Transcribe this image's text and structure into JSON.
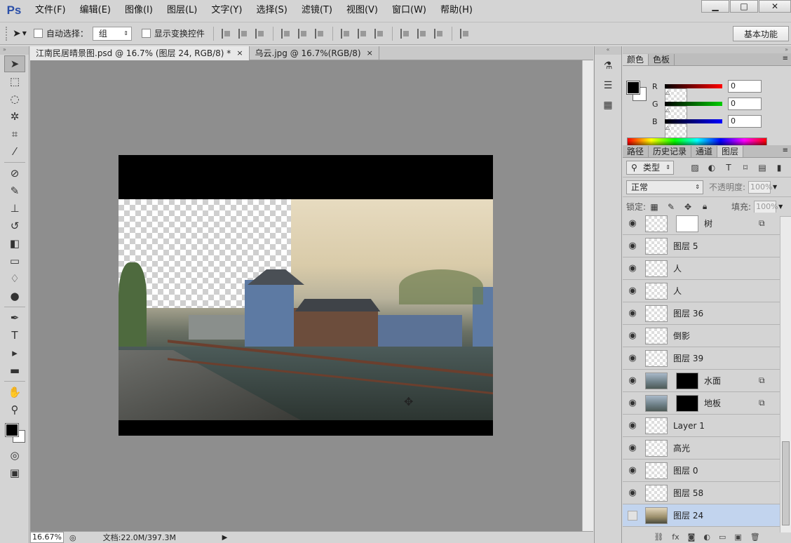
{
  "app": {
    "logo": "Ps"
  },
  "menu": [
    "文件(F)",
    "编辑(E)",
    "图像(I)",
    "图层(L)",
    "文字(Y)",
    "选择(S)",
    "滤镜(T)",
    "视图(V)",
    "窗口(W)",
    "帮助(H)"
  ],
  "window_controls": {
    "minimize": "▁",
    "maximize": "□",
    "close": "✕"
  },
  "options": {
    "auto_select_label": "自动选择：",
    "auto_select_value": "组",
    "transform_controls_label": "显示变换控件",
    "workspace": "基本功能"
  },
  "tabs": [
    {
      "title": "江南民居晴景图.psd @ 16.7% (图层 24, RGB/8) *",
      "close": "×"
    },
    {
      "title": "乌云.jpg @ 16.7%(RGB/8)",
      "close": "×"
    }
  ],
  "status": {
    "zoom": "16.67%",
    "doc": "文档:22.0M/397.3M",
    "arrow": "▶"
  },
  "color_panel": {
    "tabs": [
      "颜色",
      "色板"
    ],
    "r_label": "R",
    "g_label": "G",
    "b_label": "B",
    "r": "0",
    "g": "0",
    "b": "0"
  },
  "layers_panel": {
    "tabs": [
      "路径",
      "历史记录",
      "通道",
      "图层"
    ],
    "filter_kind": "类型",
    "blend_mode": "正常",
    "opacity_label": "不透明度:",
    "opacity": "100%",
    "lock_label": "锁定:",
    "fill_label": "填充:",
    "fill": "100%",
    "layers": [
      {
        "name": "树",
        "visible": true,
        "mask": "white",
        "linked": true
      },
      {
        "name": "图层 5",
        "visible": true
      },
      {
        "name": "人",
        "visible": true
      },
      {
        "name": "人",
        "visible": true
      },
      {
        "name": "图层 36",
        "visible": true
      },
      {
        "name": "倒影",
        "visible": true
      },
      {
        "name": "图层 39",
        "visible": true
      },
      {
        "name": "水面",
        "visible": true,
        "mask": "black",
        "linked": true,
        "thumb": "photo"
      },
      {
        "name": "地板",
        "visible": true,
        "mask": "black",
        "linked": true,
        "thumb": "photo"
      },
      {
        "name": "Layer 1",
        "visible": true
      },
      {
        "name": "高光",
        "visible": true
      },
      {
        "name": "图层 0",
        "visible": true
      },
      {
        "name": "图层 58",
        "visible": true
      },
      {
        "name": "图层 24",
        "visible": false,
        "selected": true,
        "thumb": "sunset"
      }
    ]
  },
  "icons": {
    "move_tool": "move-tool-icon",
    "eye": "eye-icon",
    "link": "link-icon"
  }
}
